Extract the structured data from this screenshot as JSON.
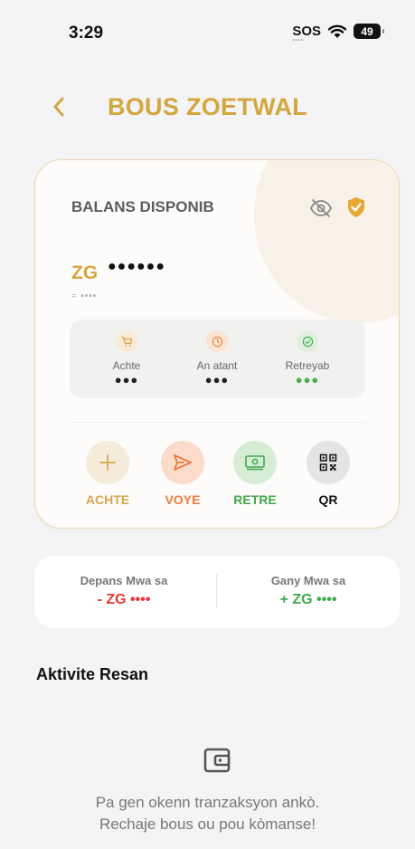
{
  "status_bar": {
    "time": "3:29",
    "sos": "SOS",
    "sos_dots": "••••",
    "battery": "49"
  },
  "header": {
    "title": "BOUS ZOETWAL",
    "back_icon": "chevron-left-icon"
  },
  "balance": {
    "label": "BALANS DISPONIB",
    "currency": "ZG",
    "amount_masked": "●●●●●●",
    "approx": "≈ ••••"
  },
  "stats": [
    {
      "label": "Achte",
      "value": "●●●",
      "icon": "cart-icon",
      "color": "#d8a54a"
    },
    {
      "label": "An atant",
      "value": "●●●",
      "icon": "clock-icon",
      "color": "#e58a4d"
    },
    {
      "label": "Retreyab",
      "value": "●●●",
      "icon": "check-circle-icon",
      "color": "#4caf50"
    }
  ],
  "actions": [
    {
      "label": "ACHTE",
      "icon": "plus-icon",
      "color": "#d8a54a"
    },
    {
      "label": "VOYE",
      "icon": "send-icon",
      "color": "#ee7a3c"
    },
    {
      "label": "RETRE",
      "icon": "cash-icon",
      "color": "#3faa4c"
    },
    {
      "label": "QR",
      "icon": "qr-icon",
      "color": "#111111"
    }
  ],
  "monthly": {
    "spent_label": "Depans Mwa sa",
    "spent_value": "- ZG ••••",
    "earned_label": "Gany Mwa sa",
    "earned_value": "+ ZG ••••"
  },
  "recent": {
    "title": "Aktivite Resan",
    "empty_line1": "Pa gen okenn tranzaksyon ankò.",
    "empty_line2": "Rechaje bous ou pou kòmanse!"
  },
  "colors": {
    "accent": "#d4a73e",
    "red": "#e53935",
    "green": "#3faa4c"
  }
}
